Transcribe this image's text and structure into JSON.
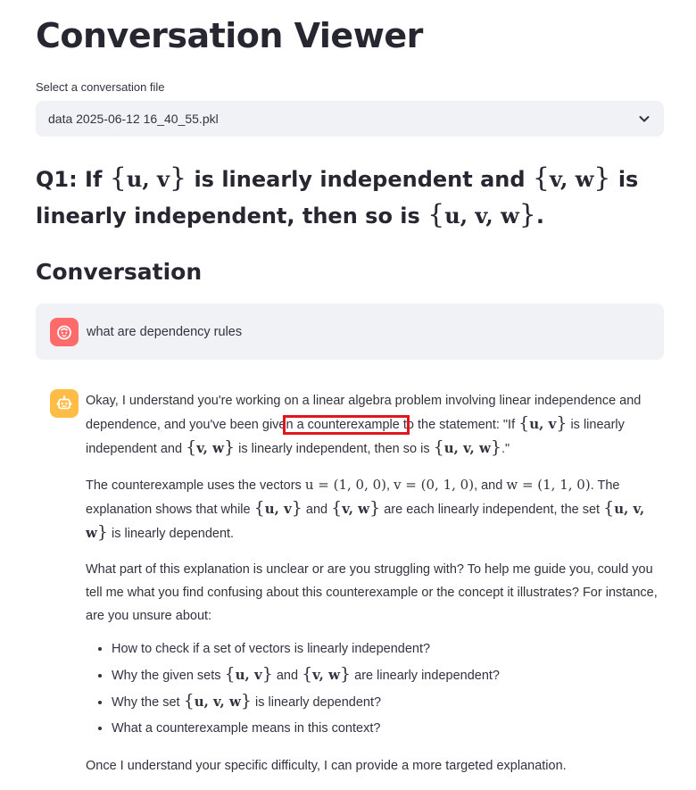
{
  "page": {
    "title": "Conversation Viewer"
  },
  "file_select": {
    "label": "Select a conversation file",
    "value": "data 2025-06-12 16_40_55.pkl",
    "icon": "chevron-down-icon"
  },
  "question": {
    "prefix": "Q1: If",
    "set_uv": "u, v",
    "mid1": "is linearly independent and",
    "set_vw": "v, w",
    "mid2": "is linearly independent, then so is",
    "set_uvw": "u, v, w",
    "end": "."
  },
  "section_heading": "Conversation",
  "messages": {
    "user": {
      "avatar_icon": "user-face-icon",
      "avatar_color": "#ff6b6b",
      "text": "what are dependency rules"
    },
    "assistant": {
      "avatar_icon": "robot-icon",
      "avatar_color": "#ffbd45",
      "p1": {
        "a": "Okay, I understand you're working on a linear algebra problem involving linear independence and dependence, and you've been give",
        "highlight": "n a counterexample t",
        "b": "o the statement: \"If",
        "set1": "u, v",
        "c": "is linearly independent and",
        "set2": "v, w",
        "d": "is linearly independent, then so is",
        "set3": "u, v, w",
        "e": ".\""
      },
      "p2": {
        "a": "The counterexample uses the vectors",
        "u": "u = (1, 0, 0)",
        "v": "v = (0, 1, 0)",
        "and": ", and",
        "w": "w = (1, 1, 0)",
        "b": ". The explanation shows that while",
        "set1": "u, v",
        "and2": "and",
        "set2": "v, w",
        "c": "are each linearly independent, the set",
        "set3": "u, v, w",
        "d": "is linearly dependent."
      },
      "p3": "What part of this explanation is unclear or are you struggling with? To help me guide you, could you tell me what you find confusing about this counterexample or the concept it illustrates? For instance, are you unsure about:",
      "bullets": {
        "b1": "How to check if a set of vectors is linearly independent?",
        "b2a": "Why the given sets",
        "b2s1": "u, v",
        "b2and": "and",
        "b2s2": "v, w",
        "b2b": "are linearly independent?",
        "b3a": "Why the set",
        "b3s": "u, v, w",
        "b3b": "is linearly dependent?",
        "b4": "What a counterexample means in this context?"
      },
      "p4": "Once I understand your specific difficulty, I can provide a more targeted explanation."
    }
  },
  "annotation": {
    "highlight_color": "#e0161c"
  }
}
